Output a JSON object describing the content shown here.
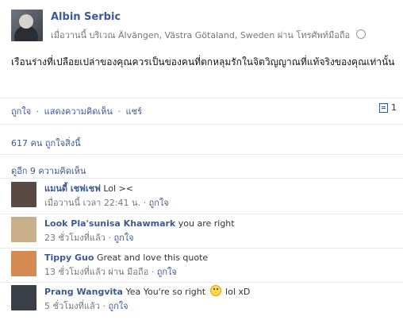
{
  "post": {
    "author": "Albin Serbic",
    "meta": "เมื่อวานนี้ บริเวณ Älvängen, Västra Götaland, Sweden ผ่าน โทรศัพท์มือถือ",
    "text": "เรือนร่างที่เปลือยเปล่าของคุณควรเป็นของคนที่ตกหลุมรักในจิตวิญญาณที่แท้จริงของคุณเท่านั้น",
    "actions": {
      "like": "ถูกใจ",
      "comment": "แสดงความคิดเห็น",
      "share": "แชร์",
      "separator": "·"
    },
    "comment_count": "1",
    "likes_text": "617 คน ถูกใจสิ่งนี้",
    "view_more": "ดูอีก 9 ความคิดเห็น",
    "icons": {
      "privacy": "globe-icon",
      "comment_count": "comment-icon"
    }
  },
  "comments": [
    {
      "name": "แมนดี้ เชฟเชฟ",
      "text": "Lol ><",
      "time": "เมื่อวานนี้ เวลา 22:41 น.",
      "like": "ถูกใจ",
      "avatar_color": "#5a4a44"
    },
    {
      "name": "Look Pla'sunisa Khawmark",
      "text": "you are right",
      "time": "23 ชั่วโมงที่แล้ว",
      "like": "ถูกใจ",
      "avatar_color": "#c9b08a"
    },
    {
      "name": "Tippy Guo",
      "text": "Great and love this quote",
      "time": "13 ชั่วโมงที่แล้ว ผ่าน มือถือ",
      "like": "ถูกใจ",
      "avatar_color": "#d58a52"
    },
    {
      "name": "Prang Wangvita",
      "text": "Yea You're so right",
      "text_after": "lol xD",
      "time": "5 ชั่วโมงที่แล้ว",
      "like": "ถูกใจ",
      "avatar_color": "#3b3f47"
    }
  ]
}
